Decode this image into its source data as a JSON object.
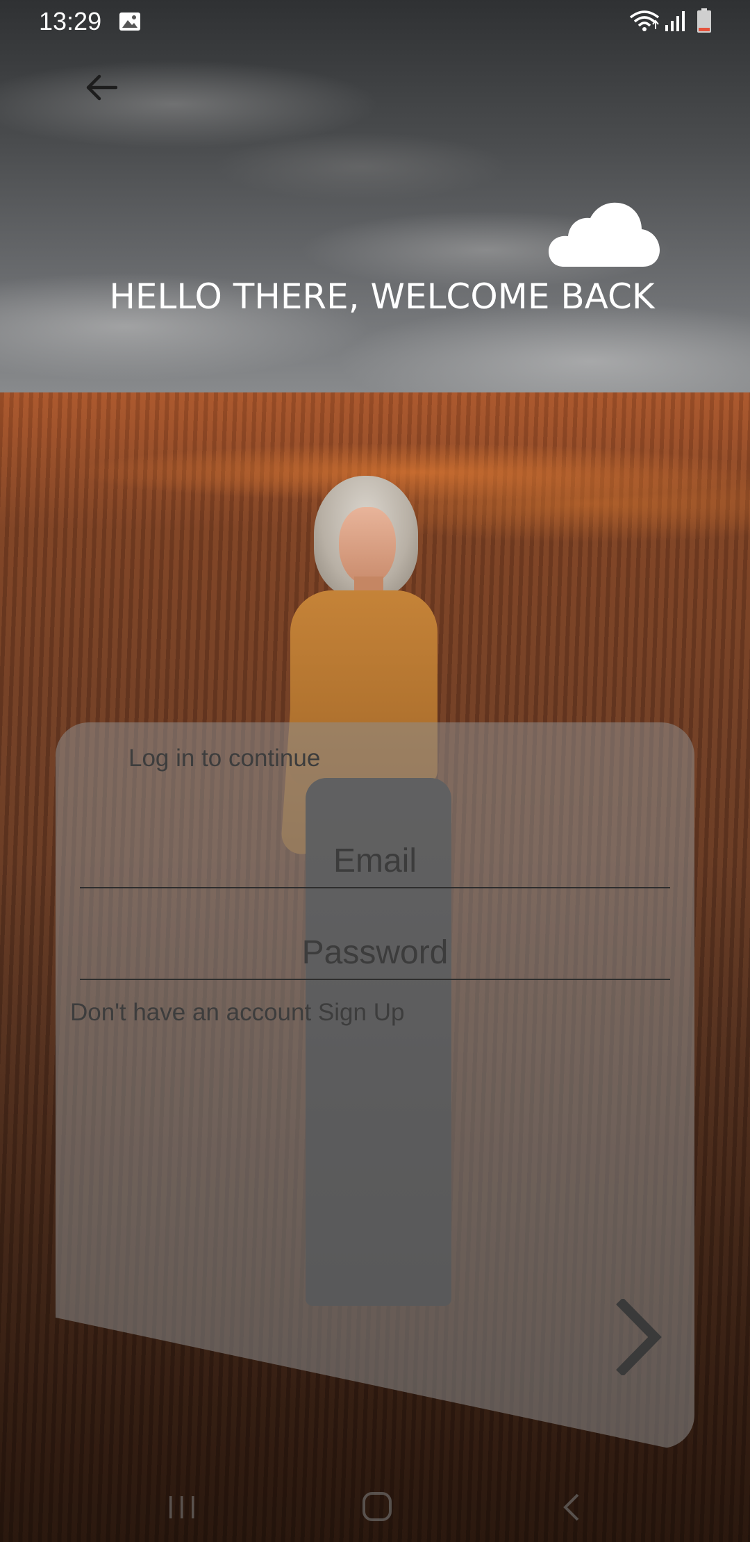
{
  "status_bar": {
    "time": "13:29",
    "icons": [
      "gallery-icon",
      "wifi-icon",
      "signal-icon",
      "battery-icon"
    ]
  },
  "header": {
    "back_icon": "arrow-left-icon",
    "cloud_icon": "cloud-icon",
    "title": "HELLO THERE, WELCOME BACK"
  },
  "login": {
    "subtitle": "Log in to continue",
    "email": {
      "placeholder": "Email",
      "value": ""
    },
    "password": {
      "placeholder": "Password",
      "value": ""
    },
    "signup_text": "Don't have an account Sign Up",
    "next_icon": "chevron-right-icon"
  },
  "nav_bar": {
    "icons": [
      "recents-icon",
      "home-icon",
      "back-icon"
    ]
  },
  "colors": {
    "title": "#ffffff",
    "card_bg": "#8c8c8c",
    "text_dark": "#3d3d3d",
    "battery_low": "#e5533d"
  }
}
